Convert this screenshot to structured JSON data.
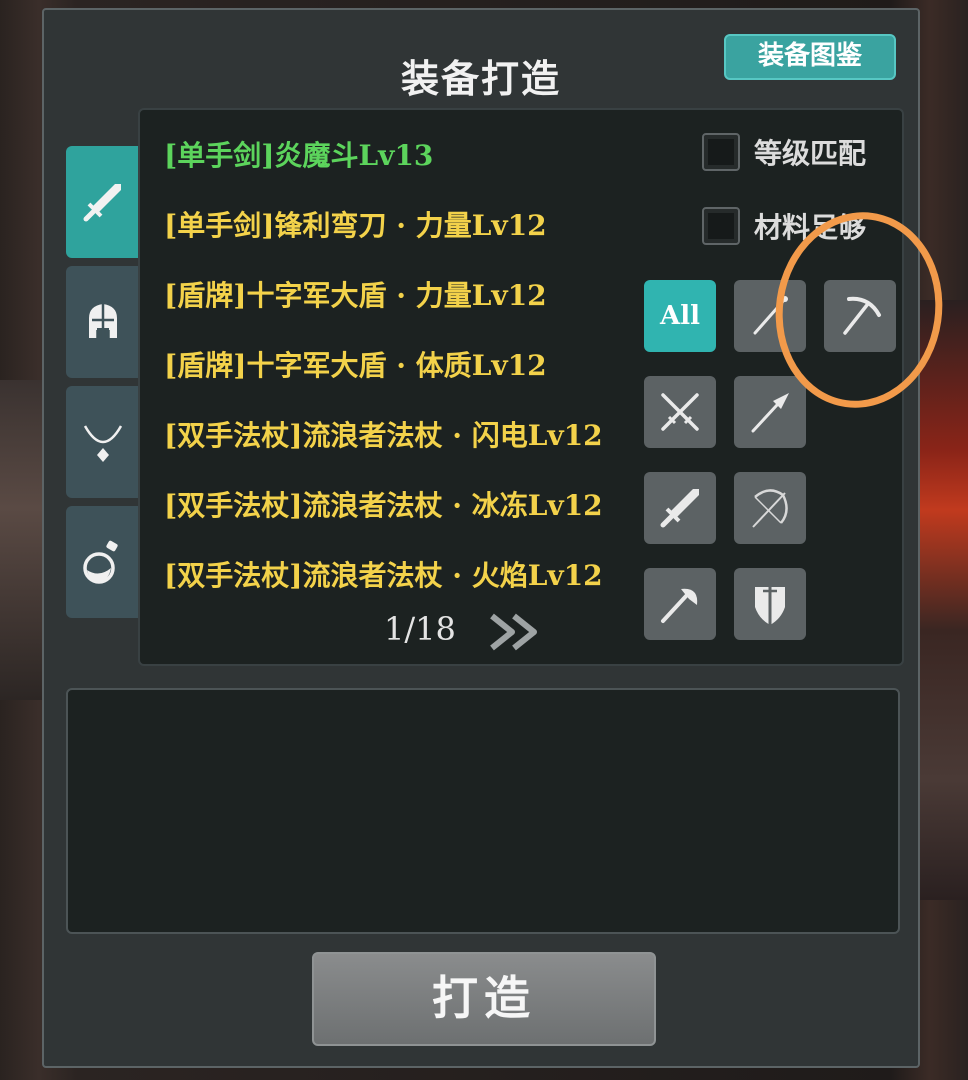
{
  "header": {
    "title": "装备打造",
    "guide_button": "装备图鉴"
  },
  "side_tabs": [
    {
      "icon": "sword-icon",
      "active": true
    },
    {
      "icon": "helmet-icon",
      "active": false
    },
    {
      "icon": "necklace-icon",
      "active": false
    },
    {
      "icon": "potion-icon",
      "active": false
    }
  ],
  "recipe_list": {
    "items": [
      {
        "label": "[单手剑]炎魔斗Lv13",
        "color": "#5cd45c"
      },
      {
        "label": "[单手剑]锋利弯刀 · 力量Lv12",
        "color": "#f3d24a"
      },
      {
        "label": "[盾牌]十字军大盾 · 力量Lv12",
        "color": "#f3d24a"
      },
      {
        "label": "[盾牌]十字军大盾 · 体质Lv12",
        "color": "#f3d24a"
      },
      {
        "label": "[双手法杖]流浪者法杖 · 闪电Lv12",
        "color": "#f3d24a"
      },
      {
        "label": "[双手法杖]流浪者法杖 · 冰冻Lv12",
        "color": "#f3d24a"
      },
      {
        "label": "[双手法杖]流浪者法杖 · 火焰Lv12",
        "color": "#f3d24a"
      }
    ],
    "pager": "1/18"
  },
  "options": {
    "level_match": "等级匹配",
    "material_enough": "材料足够"
  },
  "filters": {
    "all_label": "All",
    "icons": [
      "staff-icon",
      "pickaxe-icon",
      "dual-swords-icon",
      "spear-icon",
      "sword-icon",
      "bow-icon",
      "axe-icon",
      "shield-icon"
    ]
  },
  "forge_button": "打造",
  "colors": {
    "accent": "#30b4b0",
    "annotation": "#f29a4a"
  }
}
